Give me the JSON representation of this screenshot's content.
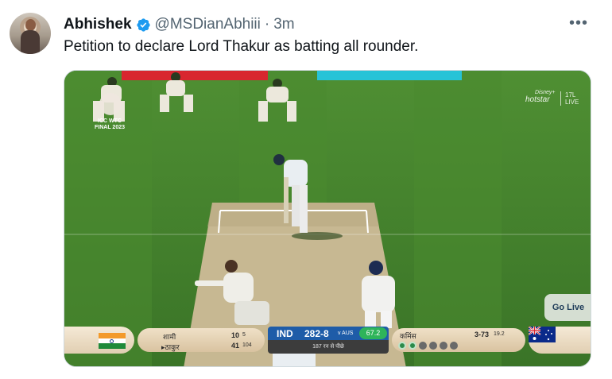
{
  "author": {
    "name": "Abhishek",
    "handle": "@MSDianAbhiii",
    "separator": "·",
    "time": "3m"
  },
  "more_label": "•••",
  "tweet_text": "Petition to declare Lord Thakur as batting all rounder.",
  "broadcast": {
    "overlay_event": "ICC WTC\nFINAL 2023",
    "hotstar_brand": "Disney+",
    "hotstar_label": "hotstar",
    "live_tag_top": "17L",
    "live_tag_bottom": "LIVE",
    "go_live": "Go Live",
    "batters": [
      {
        "name": "शामी",
        "runs": "10",
        "balls": "5"
      },
      {
        "name": "▸ठाकुर",
        "runs": "41",
        "balls": "104"
      }
    ],
    "team": "IND",
    "score": "282-8",
    "vs": "v AUS",
    "overs": "67.2",
    "trail": "187 रन से पीछे",
    "bowler": {
      "name": "कमिंस",
      "figures": "3-73",
      "overs": "19.2"
    },
    "colors": {
      "scorebox": "#1e5ca8",
      "overs": "#2eb45a",
      "pitch": "#c7b892",
      "field": "#3f7d2a"
    }
  }
}
